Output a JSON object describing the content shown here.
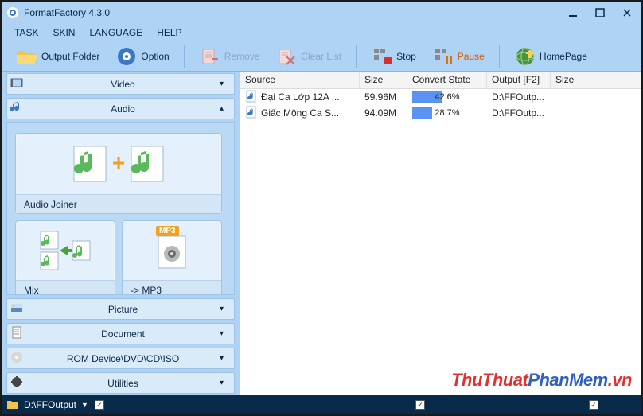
{
  "app": {
    "title": "FormatFactory 4.3.0"
  },
  "menu": {
    "task": "TASK",
    "skin": "SKIN",
    "language": "LANGUAGE",
    "help": "HELP"
  },
  "toolbar": {
    "output_folder": "Output Folder",
    "option": "Option",
    "remove": "Remove",
    "clear_list": "Clear List",
    "stop": "Stop",
    "pause": "Pause",
    "homepage": "HomePage"
  },
  "categories": {
    "video": "Video",
    "audio": "Audio",
    "picture": "Picture",
    "document": "Document",
    "rom": "ROM Device\\DVD\\CD\\ISO",
    "utilities": "Utilities"
  },
  "tiles": {
    "audio_joiner": "Audio Joiner",
    "mix": "Mix",
    "to_mp3": "-> MP3",
    "mp3_badge": "MP3"
  },
  "table": {
    "headers": {
      "source": "Source",
      "size": "Size",
      "convert_state": "Convert State",
      "output": "Output [F2]",
      "size2": "Size"
    },
    "rows": [
      {
        "source": "Đại Ca Lớp 12A ...",
        "size": "59.96M",
        "progress_pct": 42.6,
        "progress_label": "42.6%",
        "output": "D:\\FFOutp..."
      },
      {
        "source": "Giấc Mộng Ca S...",
        "size": "94.09M",
        "progress_pct": 28.7,
        "progress_label": "28.7%",
        "output": "D:\\FFOutp..."
      }
    ]
  },
  "status": {
    "path": "D:\\FFOutput"
  },
  "watermark": {
    "part1": "ThuThuat",
    "part2": "PhanMem",
    "part3": ".vn"
  }
}
